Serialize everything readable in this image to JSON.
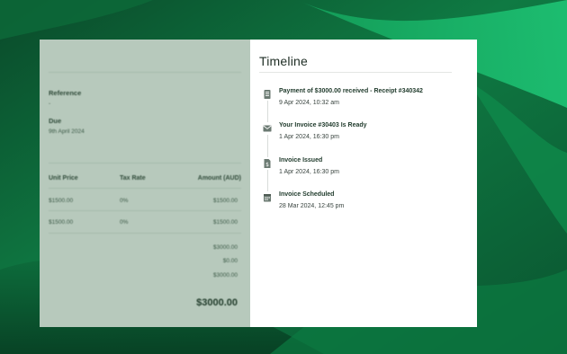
{
  "colors": {
    "background_dark": "#0b5a33",
    "background_light": "#17b96a",
    "left_panel": "#b7c9bc",
    "accent_text": "#1f3a2b",
    "icon": "#6b7a72"
  },
  "invoice": {
    "reference_label": "Reference",
    "reference_value": "-",
    "due_label": "Due",
    "due_value": "9th April 2024",
    "columns": [
      "Unit Price",
      "Tax Rate",
      "Amount (AUD)"
    ],
    "rows": [
      [
        "$1500.00",
        "0%",
        "$1500.00"
      ],
      [
        "$1500.00",
        "0%",
        "$1500.00"
      ]
    ],
    "subtotal": "$3000.00",
    "tax": "$0.00",
    "total_line": "$3000.00",
    "grand_total": "$3000.00"
  },
  "timeline": {
    "title": "Timeline",
    "events": [
      {
        "icon": "receipt-icon",
        "title": "Payment of $3000.00 received - Receipt #340342",
        "date": "9 Apr 2024, 10:32 am"
      },
      {
        "icon": "envelope-icon",
        "title": "Your Invoice #30403 Is Ready",
        "date": "1 Apr 2024, 16:30 pm"
      },
      {
        "icon": "document-dollar-icon",
        "title": "Invoice Issued",
        "date": "1 Apr 2024, 16:30 pm"
      },
      {
        "icon": "calendar-icon",
        "title": "Invoice Scheduled",
        "date": "28 Mar 2024, 12:45 pm"
      }
    ]
  }
}
